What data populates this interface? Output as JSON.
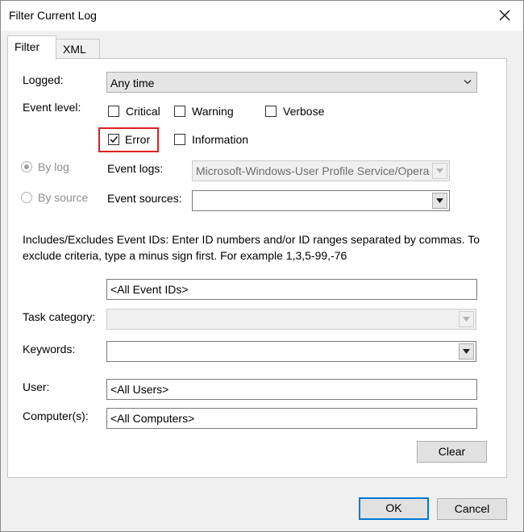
{
  "window": {
    "title": "Filter Current Log"
  },
  "tabs": [
    {
      "label": "Filter"
    },
    {
      "label": "XML"
    }
  ],
  "filter": {
    "logged_label": "Logged:",
    "logged_value": "Any time",
    "event_level_label": "Event level:",
    "levels": {
      "critical": {
        "label": "Critical",
        "checked": false
      },
      "warning": {
        "label": "Warning",
        "checked": false
      },
      "verbose": {
        "label": "Verbose",
        "checked": false
      },
      "error": {
        "label": "Error",
        "checked": true
      },
      "information": {
        "label": "Information",
        "checked": false
      }
    },
    "by_log_label": "By log",
    "by_source_label": "By source",
    "event_logs_label": "Event logs:",
    "event_logs_value": "Microsoft-Windows-User Profile Service/Opera",
    "event_sources_label": "Event sources:",
    "event_sources_value": "",
    "ids_description": "Includes/Excludes Event IDs: Enter ID numbers and/or ID ranges separated by commas. To exclude criteria, type a minus sign first. For example 1,3,5-99,-76",
    "event_ids_value": "<All Event IDs>",
    "task_category_label": "Task category:",
    "task_category_value": "",
    "keywords_label": "Keywords:",
    "keywords_value": "",
    "user_label": "User:",
    "user_value": "<All Users>",
    "computer_label": "Computer(s):",
    "computer_value": "<All Computers>",
    "clear_label": "Clear"
  },
  "footer": {
    "ok_label": "OK",
    "cancel_label": "Cancel"
  },
  "colors": {
    "highlight": "#e02020",
    "accent": "#0078d7"
  }
}
